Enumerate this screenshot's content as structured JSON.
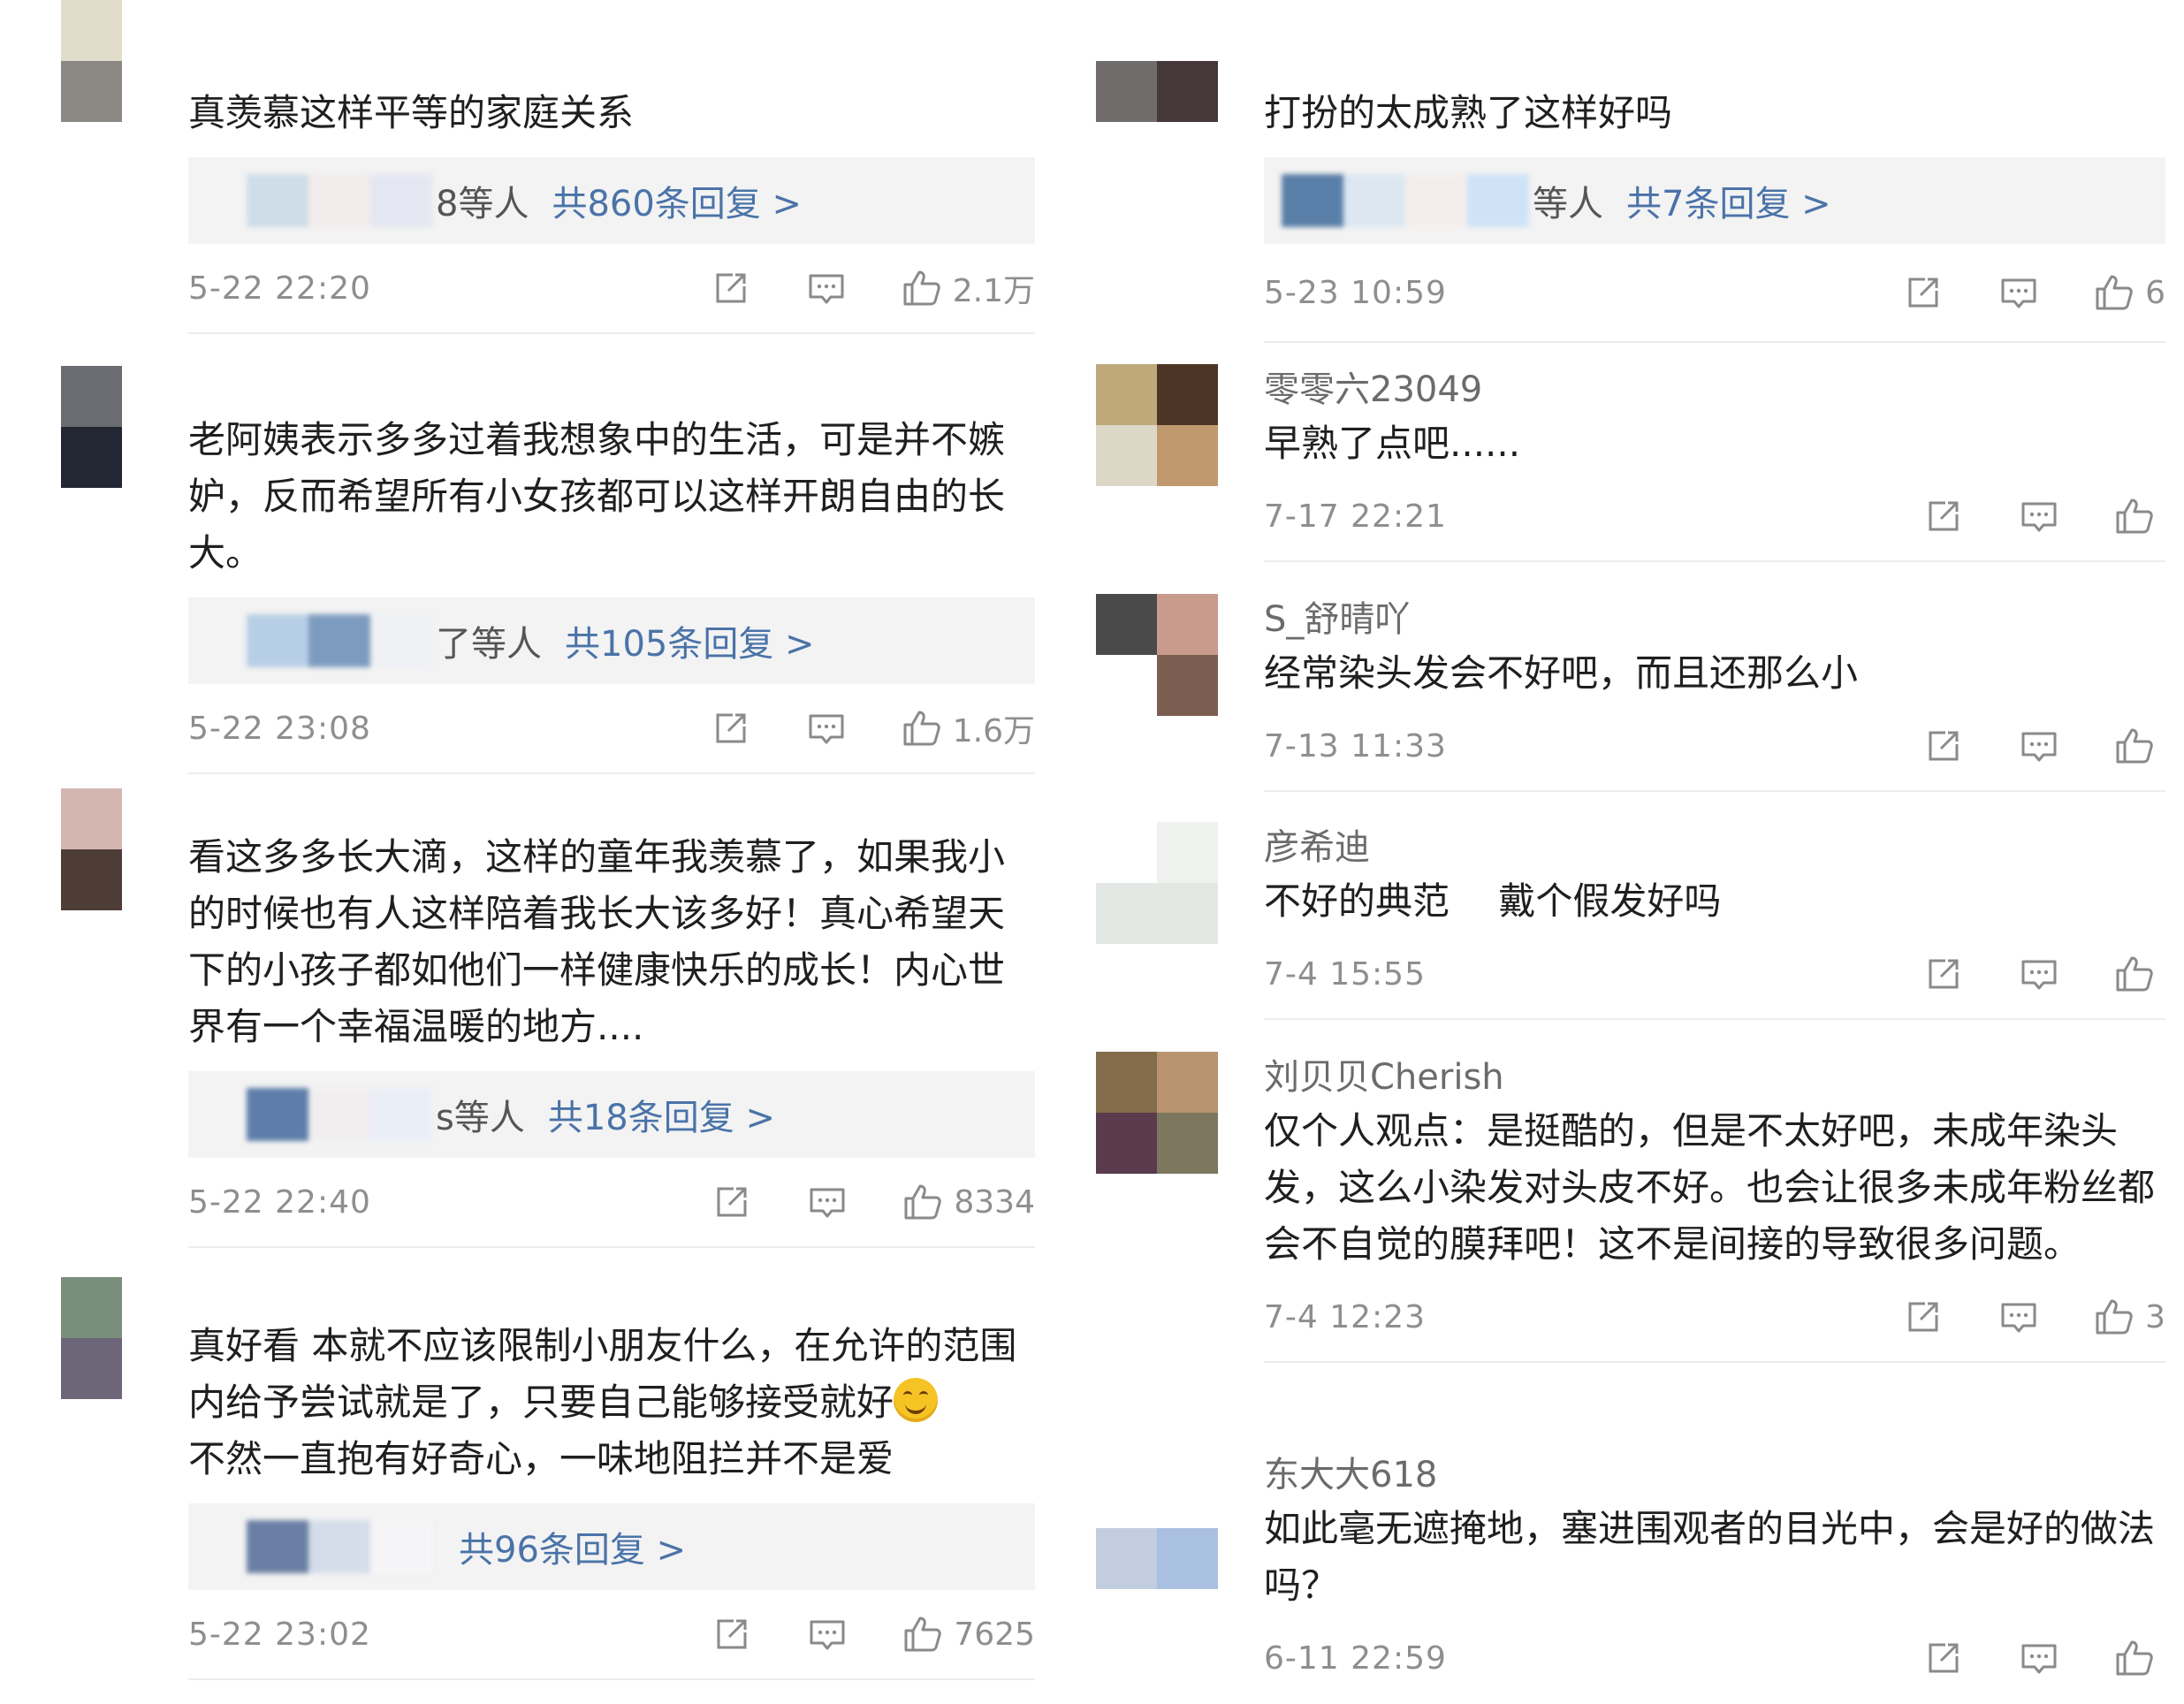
{
  "colors": {
    "reply_link": "#4a73a8",
    "reply_bg": "#f3f3f3",
    "meta_text": "#8e8e8e",
    "icon": "#8a8a8a"
  },
  "icons": [
    "share-icon",
    "comment-icon",
    "like-icon",
    "smile-emoji"
  ],
  "left_comments": [
    {
      "username": "",
      "text": "真羡慕这样平等的家庭关系",
      "reply_who": "8等人",
      "reply_count": "共860条回复 >",
      "time": "5-22 22:20",
      "likes": "2.1万"
    },
    {
      "username": "",
      "text": "老阿姨表示多多过着我想象中的生活，可是并不嫉妒，反而希望所有小女孩都可以这样开朗自由的长大。",
      "reply_who": "了等人",
      "reply_count": "共105条回复 >",
      "time": "5-22 23:08",
      "likes": "1.6万"
    },
    {
      "username": "",
      "text": "看这多多长大滴，这样的童年我羡慕了，如果我小的时候也有人这样陪着我长大该多好！真心希望天下的小孩子都如他们一样健康快乐的成长！内心世界有一个幸福温暖的地方....",
      "reply_who": "s等人",
      "reply_count": "共18条回复 >",
      "time": "5-22 22:40",
      "likes": "8334"
    },
    {
      "username": "",
      "text_a": "真好看 本就不应该限制小朋友什么，在允许的范围内给予尝试就是了，只要自己能够接受就好",
      "text_b": "不然一直抱有好奇心，一味地阻拦并不是爱",
      "reply_who": "",
      "reply_count": "共96条回复 >",
      "time": "5-22 23:02",
      "likes": "7625"
    }
  ],
  "right_comments": [
    {
      "username": "",
      "text": "打扮的太成熟了这样好吗",
      "reply_who": "等人",
      "reply_count": "共7条回复 >",
      "time": "5-23 10:59",
      "likes": "6"
    },
    {
      "username": "零零六23049",
      "text": "早熟了点吧......",
      "time": "7-17 22:21",
      "likes": ""
    },
    {
      "username": "S_舒晴吖",
      "text": "经常染头发会不好吧，而且还那么小",
      "time": "7-13 11:33",
      "likes": ""
    },
    {
      "username": "彦希迪",
      "text": "不好的典范　 戴个假发好吗",
      "time": "7-4 15:55",
      "likes": ""
    },
    {
      "username": "刘贝贝Cherish",
      "text": "仅个人观点：是挺酷的，但是不太好吧，未成年染头发，这么小染发对头皮不好。也会让很多未成年粉丝都会不自觉的膜拜吧！这不是间接的导致很多问题。",
      "time": "7-4 12:23",
      "likes": "3"
    },
    {
      "username": "东大大618",
      "text": "如此毫无遮掩地，塞进围观者的目光中，会是好的做法吗？",
      "time": "6-11 22:59",
      "likes": ""
    }
  ]
}
